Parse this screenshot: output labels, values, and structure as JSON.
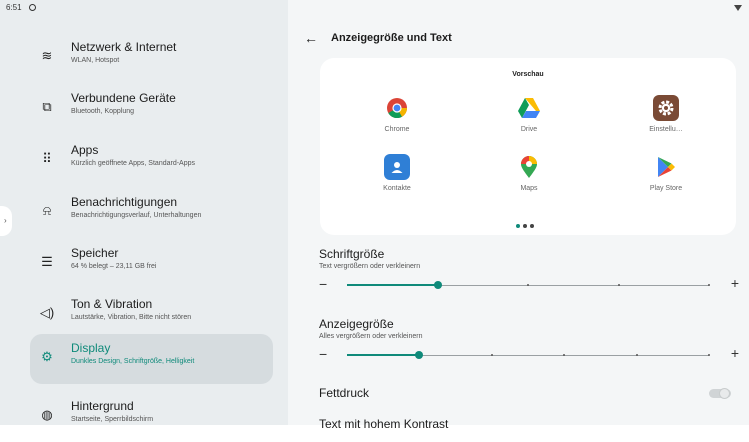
{
  "status": {
    "time": "6:51"
  },
  "sidebar": {
    "items": [
      {
        "title": "Netzwerk & Internet",
        "subtitle": "WLAN, Hotspot",
        "icon": "wifi-icon",
        "glyph": "≋"
      },
      {
        "title": "Verbundene Geräte",
        "subtitle": "Bluetooth, Kopplung",
        "icon": "connected-devices-icon",
        "glyph": "⧉"
      },
      {
        "title": "Apps",
        "subtitle": "Kürzlich geöffnete Apps, Standard-Apps",
        "icon": "apps-grid-icon",
        "glyph": "⠿"
      },
      {
        "title": "Benachrichtigungen",
        "subtitle": "Benachrichtigungsverlauf, Unterhaltungen",
        "icon": "bell-icon",
        "glyph": "⍾"
      },
      {
        "title": "Speicher",
        "subtitle": "64 % belegt – 23,11 GB frei",
        "icon": "storage-icon",
        "glyph": "☰"
      },
      {
        "title": "Ton & Vibration",
        "subtitle": "Lautstärke, Vibration, Bitte nicht stören",
        "icon": "speaker-icon",
        "glyph": "◁)"
      },
      {
        "title": "Display",
        "subtitle": "Dunkles Design, Schriftgröße, Helligkeit",
        "icon": "brightness-icon",
        "glyph": "⚙"
      },
      {
        "title": "Hintergrund",
        "subtitle": "Startseite, Sperrbildschirm",
        "icon": "palette-icon",
        "glyph": "◍"
      }
    ],
    "active_index": 6
  },
  "header": {
    "title": "Anzeigegröße und Text"
  },
  "preview": {
    "label": "Vorschau",
    "apps": [
      {
        "label": "Chrome",
        "icon": "chrome-icon"
      },
      {
        "label": "Drive",
        "icon": "drive-icon"
      },
      {
        "label": "Einstellu…",
        "icon": "settings-app-icon"
      },
      {
        "label": "Kontakte",
        "icon": "contacts-icon"
      },
      {
        "label": "Maps",
        "icon": "maps-icon"
      },
      {
        "label": "Play Store",
        "icon": "play-store-icon"
      }
    ],
    "page_dots": 3,
    "active_dot": 0
  },
  "font_size": {
    "title": "Schriftgröße",
    "subtitle": "Text vergrößern oder verkleinern",
    "minus": "−",
    "plus": "+",
    "steps": 4,
    "value_index": 1
  },
  "display_size": {
    "title": "Anzeigegröße",
    "subtitle": "Alles vergrößern oder verkleinern",
    "minus": "−",
    "plus": "+",
    "steps": 5,
    "value_index": 1
  },
  "bold_text": {
    "title": "Fettdruck",
    "enabled": false
  },
  "high_contrast": {
    "title": "Text mit hohem Kontrast"
  },
  "colors": {
    "accent": "#0f8a7a",
    "sidebar_bg": "#e9edef",
    "content_bg": "#f4f6f7"
  }
}
